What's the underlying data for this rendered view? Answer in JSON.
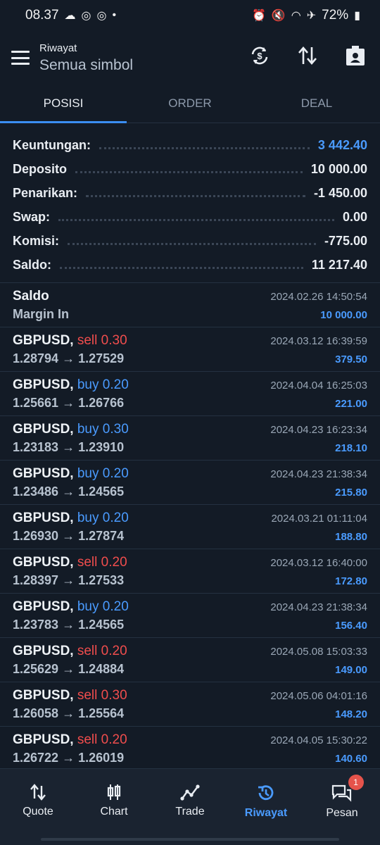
{
  "status": {
    "time": "08.37",
    "battery": "72%"
  },
  "header": {
    "title": "Riwayat",
    "subtitle": "Semua simbol"
  },
  "tabs": [
    {
      "label": "POSISI"
    },
    {
      "label": "ORDER"
    },
    {
      "label": "DEAL"
    }
  ],
  "summary": [
    {
      "label": "Keuntungan:",
      "value": "3 442.40"
    },
    {
      "label": "Deposito",
      "value": "10 000.00"
    },
    {
      "label": "Penarikan:",
      "value": "-1 450.00"
    },
    {
      "label": "Swap:",
      "value": "0.00"
    },
    {
      "label": "Komisi:",
      "value": "-775.00"
    },
    {
      "label": "Saldo:",
      "value": "11 217.40"
    }
  ],
  "balance_entry": {
    "title": "Saldo",
    "subtitle": "Margin In",
    "datetime": "2024.02.26 14:50:54",
    "amount": "10 000.00"
  },
  "deals": [
    {
      "symbol": "GBPUSD,",
      "side": "sell",
      "volume": "0.30",
      "prices": "1.28794 → 1.27529",
      "datetime": "2024.03.12 16:39:59",
      "profit": "379.50"
    },
    {
      "symbol": "GBPUSD,",
      "side": "buy",
      "volume": "0.20",
      "prices": "1.25661 → 1.26766",
      "datetime": "2024.04.04 16:25:03",
      "profit": "221.00"
    },
    {
      "symbol": "GBPUSD,",
      "side": "buy",
      "volume": "0.30",
      "prices": "1.23183 → 1.23910",
      "datetime": "2024.04.23 16:23:34",
      "profit": "218.10"
    },
    {
      "symbol": "GBPUSD,",
      "side": "buy",
      "volume": "0.20",
      "prices": "1.23486 → 1.24565",
      "datetime": "2024.04.23 21:38:34",
      "profit": "215.80"
    },
    {
      "symbol": "GBPUSD,",
      "side": "buy",
      "volume": "0.20",
      "prices": "1.26930 → 1.27874",
      "datetime": "2024.03.21 01:11:04",
      "profit": "188.80"
    },
    {
      "symbol": "GBPUSD,",
      "side": "sell",
      "volume": "0.20",
      "prices": "1.28397 → 1.27533",
      "datetime": "2024.03.12 16:40:00",
      "profit": "172.80"
    },
    {
      "symbol": "GBPUSD,",
      "side": "buy",
      "volume": "0.20",
      "prices": "1.23783 → 1.24565",
      "datetime": "2024.04.23 21:38:34",
      "profit": "156.40"
    },
    {
      "symbol": "GBPUSD,",
      "side": "sell",
      "volume": "0.20",
      "prices": "1.25629 → 1.24884",
      "datetime": "2024.05.08 15:03:33",
      "profit": "149.00"
    },
    {
      "symbol": "GBPUSD,",
      "side": "sell",
      "volume": "0.30",
      "prices": "1.26058 → 1.25564",
      "datetime": "2024.05.06 04:01:16",
      "profit": "148.20"
    },
    {
      "symbol": "GBPUSD,",
      "side": "sell",
      "volume": "0.20",
      "prices": "1.26722 → 1.26019",
      "datetime": "2024.04.05 15:30:22",
      "profit": "140.60"
    }
  ],
  "bottom_nav": [
    {
      "label": "Quote",
      "icon": "quote-arrows-icon"
    },
    {
      "label": "Chart",
      "icon": "candlestick-icon"
    },
    {
      "label": "Trade",
      "icon": "trade-line-icon"
    },
    {
      "label": "Riwayat",
      "icon": "history-clock-icon"
    },
    {
      "label": "Pesan",
      "icon": "chat-icon",
      "badge": "1"
    }
  ],
  "colors": {
    "accent": "#4a9bff",
    "sell": "#f04d4d",
    "background": "#131b26"
  }
}
